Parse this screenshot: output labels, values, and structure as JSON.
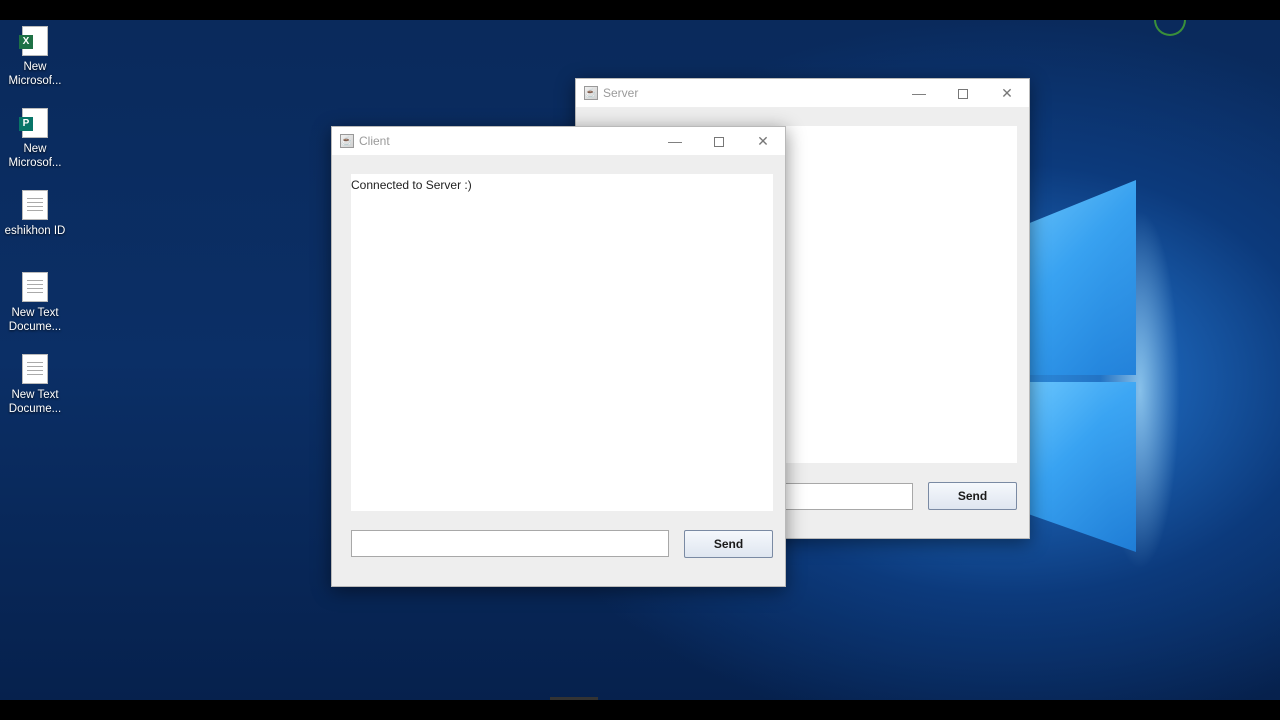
{
  "desktop": {
    "icons": [
      {
        "label_line1": "New",
        "label_line2": "Microsof...",
        "icon": "excel-file-icon"
      },
      {
        "label_line1": "New",
        "label_line2": "Microsof...",
        "icon": "publisher-file-icon"
      },
      {
        "label_line1": "eshikhon ID",
        "label_line2": "",
        "icon": "text-document-icon"
      },
      {
        "label_line1": "New Text",
        "label_line2": "Docume...",
        "icon": "text-document-icon"
      },
      {
        "label_line1": "New Text",
        "label_line2": "Docume...",
        "icon": "text-document-icon"
      }
    ]
  },
  "server_window": {
    "title": "Server",
    "messages": [],
    "input_value": "",
    "send_label": "Send"
  },
  "client_window": {
    "title": "Client",
    "messages": [
      "Connected to Server :)"
    ],
    "input_value": "",
    "send_label": "Send"
  },
  "window_controls": {
    "minimize_glyph": "—",
    "close_glyph": "✕"
  }
}
